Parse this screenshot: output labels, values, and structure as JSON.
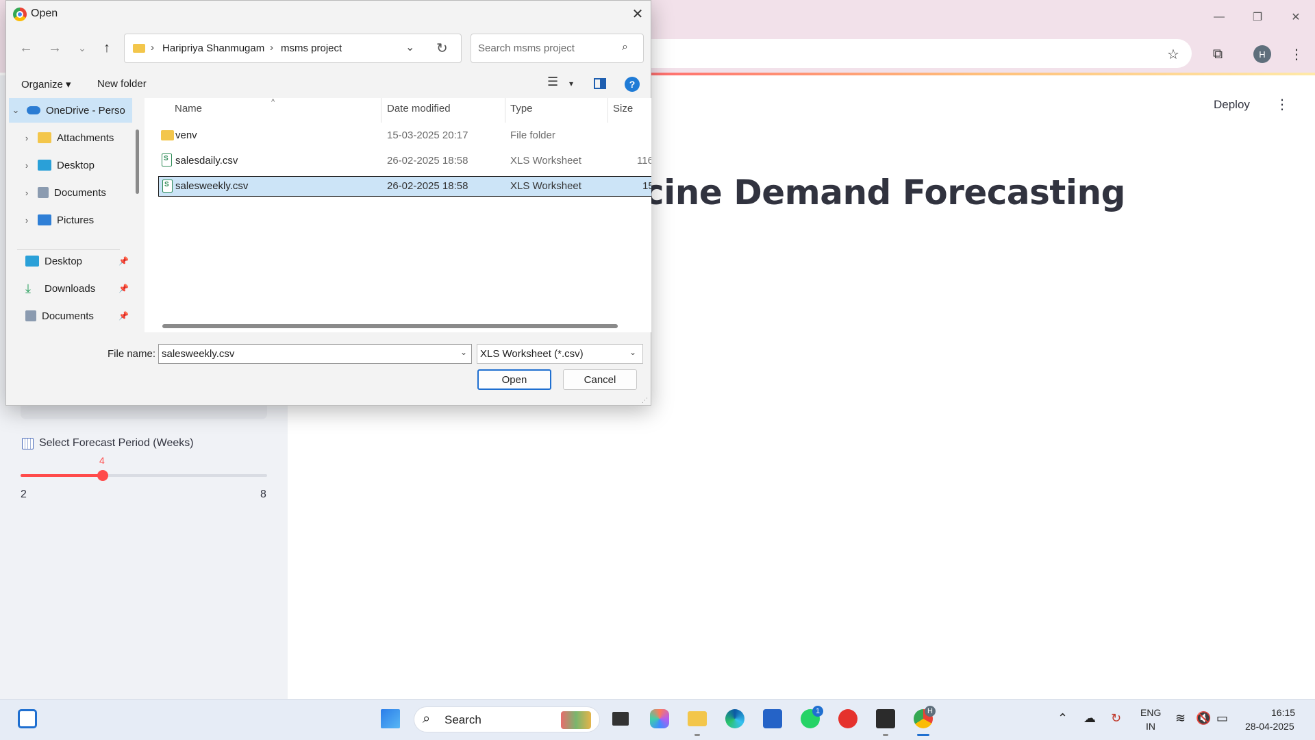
{
  "browser": {
    "deploy_label": "Deploy",
    "profile_initial": "H",
    "menu_glyph": "⋮"
  },
  "page": {
    "title_visible": "cine Demand Forecasting",
    "slider": {
      "label": "Select Forecast Period (Weeks)",
      "value": "4",
      "value_num": 4,
      "min": "2",
      "max": "8",
      "min_num": 2,
      "max_num": 8
    },
    "accent_color": "#ff4b4b"
  },
  "dialog": {
    "title": "Open",
    "breadcrumb": [
      "Haripriya Shanmugam",
      "msms project"
    ],
    "search_placeholder": "Search msms project",
    "organize_label": "Organize ▾",
    "new_folder_label": "New folder",
    "help_glyph": "?",
    "nav": {
      "onedrive": "OneDrive - Perso",
      "items": [
        "Attachments",
        "Desktop",
        "Documents",
        "Pictures"
      ],
      "quick_access": [
        "Desktop",
        "Downloads",
        "Documents"
      ]
    },
    "columns": {
      "name": "Name",
      "date": "Date modified",
      "type": "Type",
      "size": "Size"
    },
    "files": [
      {
        "name": "venv",
        "date": "15-03-2025 20:17",
        "type": "File folder",
        "size": "",
        "kind": "folder"
      },
      {
        "name": "salesdaily.csv",
        "date": "26-02-2025 18:58",
        "type": "XLS Worksheet",
        "size": "116",
        "kind": "csv"
      },
      {
        "name": "salesweekly.csv",
        "date": "26-02-2025 18:58",
        "type": "XLS Worksheet",
        "size": "15",
        "kind": "csv",
        "selected": true
      }
    ],
    "file_name_label": "File name:",
    "file_name_value": "salesweekly.csv",
    "file_type_value": "XLS Worksheet (*.csv)",
    "open_label": "Open",
    "cancel_label": "Cancel"
  },
  "taskbar": {
    "search_label": "Search",
    "whatsapp_badge": "1",
    "chrome_badge": "H",
    "lang_line1": "ENG",
    "lang_line2": "IN",
    "time": "16:15",
    "date": "28-04-2025"
  }
}
